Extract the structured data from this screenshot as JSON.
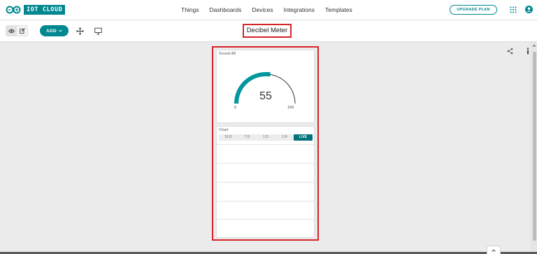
{
  "brand": {
    "name": "IOT CLOUD",
    "accent": "#00878F"
  },
  "nav": {
    "links": [
      "Things",
      "Dashboards",
      "Devices",
      "Integrations",
      "Templates"
    ],
    "upgrade_label": "UPGRADE PLAN",
    "apps_icon": "apps-grid-icon",
    "user_icon": "user-avatar-icon"
  },
  "toolbar": {
    "mode": "view",
    "add_label": "ADD",
    "dashboard_title": "Decibel Meter",
    "icons": [
      "eye-icon",
      "pencil-icon",
      "move-icon",
      "present-icon",
      "share-icon",
      "info-icon"
    ]
  },
  "widgets": {
    "gauge": {
      "label": "Sound dB",
      "value": "55",
      "value_fraction": 0.55,
      "min": "0",
      "max": "100"
    },
    "chart": {
      "label": "Chart",
      "ranges": [
        "15 D",
        "7 D",
        "1 D",
        "1 H",
        "LIVE"
      ],
      "active_range": "LIVE"
    }
  },
  "annotation_color": "#D8232A"
}
